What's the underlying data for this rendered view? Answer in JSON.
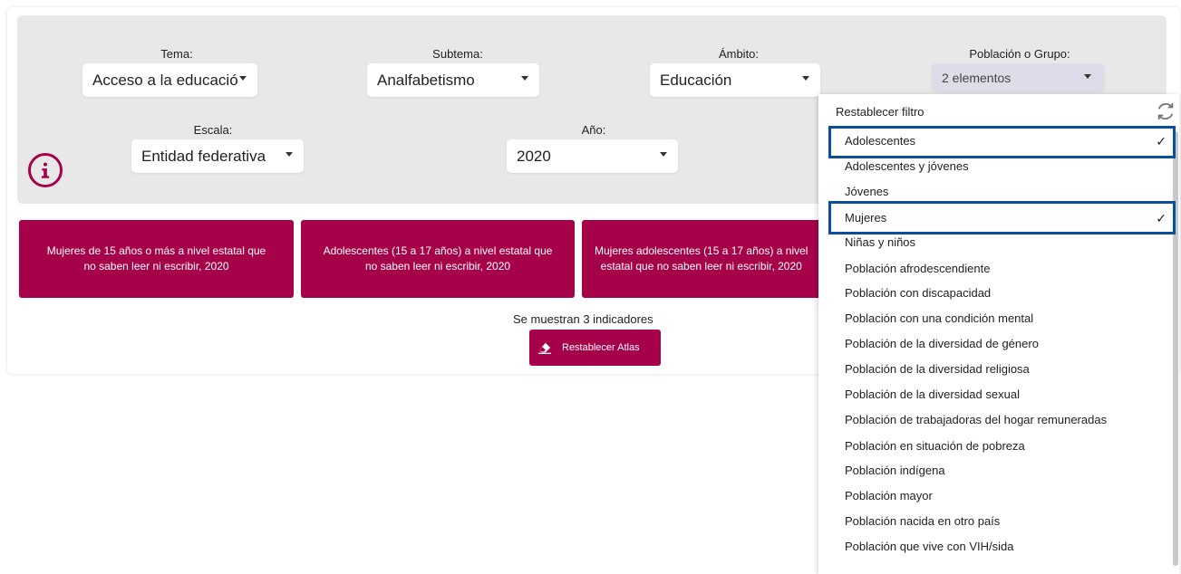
{
  "filters": {
    "tema": {
      "label": "Tema:",
      "value": "Acceso a la educació"
    },
    "subtema": {
      "label": "Subtema:",
      "value": "Analfabetismo"
    },
    "ambito": {
      "label": "Ámbito:",
      "value": "Educación"
    },
    "poblacion": {
      "label": "Población o Grupo:",
      "value": "2 elementos"
    },
    "escala": {
      "label": "Escala:",
      "value": "Entidad federativa"
    },
    "anio": {
      "label": "Año:",
      "value": "2020"
    }
  },
  "indicators": [
    {
      "line1": "Mujeres de 15 años o más a nivel estatal que",
      "line2": "no saben leer ni escribir, 2020"
    },
    {
      "line1": "Adolescentes (15 a 17 años) a nivel estatal que",
      "line2": "no saben leer ni escribir, 2020"
    },
    {
      "line1": "Mujeres adolescentes (15 a 17 años) a nivel",
      "line2": "estatal que no saben leer ni escribir, 2020"
    }
  ],
  "summary": {
    "count_text": "Se muestran 3 indicadores",
    "reset_atlas": "Restablecer Atlas"
  },
  "dropdown": {
    "reset_label": "Restablecer filtro",
    "items": [
      {
        "label": "Adolescentes",
        "checked": true
      },
      {
        "label": "Adolescentes y jóvenes",
        "checked": false
      },
      {
        "label": "Jóvenes",
        "checked": false
      },
      {
        "label": "Mujeres",
        "checked": true
      },
      {
        "label": "Niñas y niños",
        "checked": false
      },
      {
        "label": "Población afrodescendiente",
        "checked": false
      },
      {
        "label": "Población con discapacidad",
        "checked": false
      },
      {
        "label": "Población con una condición mental",
        "checked": false
      },
      {
        "label": "Población de la diversidad de género",
        "checked": false
      },
      {
        "label": "Población de la diversidad religiosa",
        "checked": false
      },
      {
        "label": "Población de la diversidad sexual",
        "checked": false
      },
      {
        "label": "Población de trabajadoras del hogar remuneradas",
        "checked": false
      },
      {
        "label": "Población en situación de pobreza",
        "checked": false
      },
      {
        "label": "Población indígena",
        "checked": false
      },
      {
        "label": "Población mayor",
        "checked": false
      },
      {
        "label": "Población nacida en otro país",
        "checked": false
      },
      {
        "label": "Población que vive con VIH/sida",
        "checked": false
      }
    ],
    "check_glyph": "✓"
  },
  "colors": {
    "brand": "#a6004a",
    "highlight": "#0a4f9b",
    "panel": "#e8e8e8"
  },
  "icons": {
    "info": "info-icon",
    "refresh": "refresh-icon",
    "eraser": "eraser-icon"
  }
}
